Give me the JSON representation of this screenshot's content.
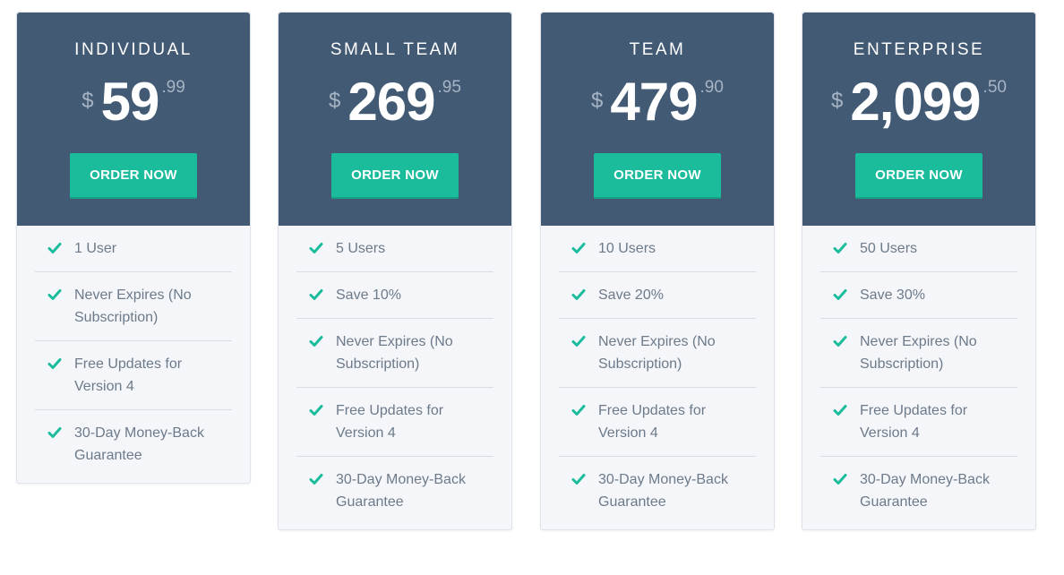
{
  "colors": {
    "header": "#425a74",
    "accent": "#1abc9c",
    "body": "#f5f6fa",
    "text": "#6c7a89"
  },
  "plans": [
    {
      "name": "INDIVIDUAL",
      "currency": "$",
      "amount": "59",
      "cents": ".99",
      "button": "ORDER NOW",
      "features": [
        "1 User",
        "Never Expires (No Subscription)",
        "Free Updates for Version 4",
        "30-Day Money-Back Guarantee"
      ]
    },
    {
      "name": "SMALL TEAM",
      "currency": "$",
      "amount": "269",
      "cents": ".95",
      "button": "ORDER NOW",
      "features": [
        "5 Users",
        "Save 10%",
        "Never Expires (No Subscription)",
        "Free Updates for Version 4",
        "30-Day Money-Back Guarantee"
      ]
    },
    {
      "name": "TEAM",
      "currency": "$",
      "amount": "479",
      "cents": ".90",
      "button": "ORDER NOW",
      "features": [
        "10 Users",
        "Save 20%",
        "Never Expires (No Subscription)",
        "Free Updates for Version 4",
        "30-Day Money-Back Guarantee"
      ]
    },
    {
      "name": "ENTERPRISE",
      "currency": "$",
      "amount": "2,099",
      "cents": ".50",
      "button": "ORDER NOW",
      "features": [
        "50 Users",
        "Save 30%",
        "Never Expires (No Subscription)",
        "Free Updates for Version 4",
        "30-Day Money-Back Guarantee"
      ]
    }
  ]
}
